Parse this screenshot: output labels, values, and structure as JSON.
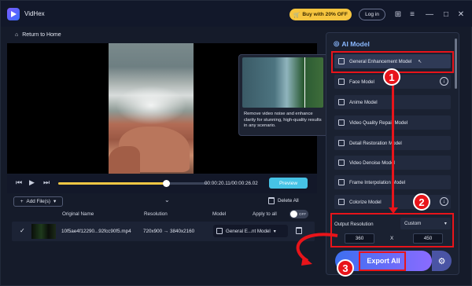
{
  "app": {
    "name": "VidHex"
  },
  "titlebar": {
    "buy_label": "Buy with 20% OFF",
    "login_label": "Log in"
  },
  "nav": {
    "home_label": "Return to Home"
  },
  "tooltip": {
    "text": "Remove video noise and enhance clarity for stunning, high-quality results in any scenario."
  },
  "player": {
    "time": "00:00:20.11/00:00:26.02",
    "preview_label": "Preview",
    "progress": 0.71
  },
  "list": {
    "add_label": "Add File(s)",
    "delete_all_label": "Delete All",
    "apply_all_label": "Apply to all",
    "toggle_label": "OFF",
    "headers": {
      "name": "Original Name",
      "resolution": "Resolution",
      "model": "Model"
    },
    "rows": [
      {
        "name": "10f5ae4f12290...92fcc90f5.mp4",
        "resolution": "720x900 → 3840x2160",
        "model": "General E...nt Model"
      }
    ]
  },
  "panel": {
    "title": "AI Model",
    "models": [
      {
        "label": "General Enhancement Model",
        "selected": true
      },
      {
        "label": "Face Model",
        "download": true
      },
      {
        "label": "Anime Model"
      },
      {
        "label": "Video Quality Repair Model"
      },
      {
        "label": "Detail Restoration Model"
      },
      {
        "label": "Video Denoise Model"
      },
      {
        "label": "Frame Interpolation Model"
      },
      {
        "label": "Colorize Model",
        "download": true
      }
    ],
    "output_label": "Output Resolution",
    "output_mode": "Custom",
    "width": "360",
    "x_label": "X",
    "height": "450",
    "export_label": "Export All"
  },
  "annotations": {
    "step1": "1",
    "step2": "2",
    "step3": "3"
  },
  "colors": {
    "accent": "#f2c744",
    "annotation": "#e8141a",
    "preview": "#46c3e6"
  }
}
